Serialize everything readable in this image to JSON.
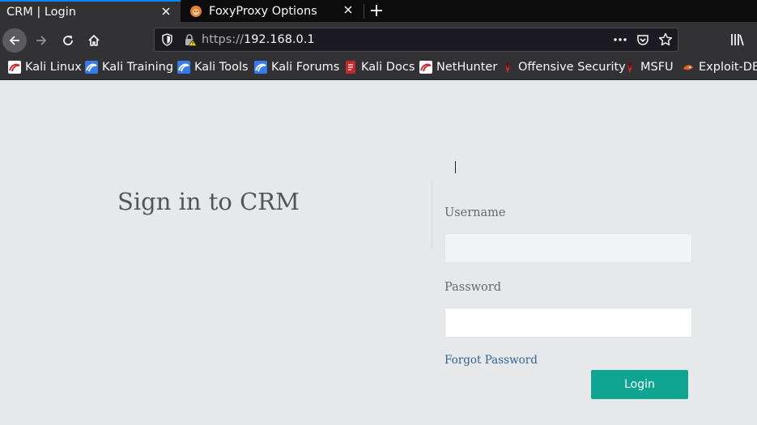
{
  "tabs": [
    {
      "title": "CRM | Login",
      "active": true
    },
    {
      "title": "FoxyProxy Options",
      "active": false
    }
  ],
  "navbar": {
    "url_scheme": "https://",
    "url_host": "192.168.0.1"
  },
  "bookmarks": [
    {
      "label": "Kali Linux",
      "icon": "kali-dragon-icon"
    },
    {
      "label": "Kali Training",
      "icon": "kali-training-icon"
    },
    {
      "label": "Kali Tools",
      "icon": "kali-tools-icon"
    },
    {
      "label": "Kali Forums",
      "icon": "kali-forums-icon"
    },
    {
      "label": "Kali Docs",
      "icon": "kali-docs-icon"
    },
    {
      "label": "NetHunter",
      "icon": "nethunter-icon"
    },
    {
      "label": "Offensive Security",
      "icon": "offsec-icon"
    },
    {
      "label": "MSFU",
      "icon": "msfu-icon"
    },
    {
      "label": "Exploit-DB",
      "icon": "exploit-db-icon"
    }
  ],
  "login": {
    "heading": "Sign in to CRM",
    "username_label": "Username",
    "username_value": "",
    "password_label": "Password",
    "password_value": "",
    "forgot_label": "Forgot Password",
    "submit_label": "Login"
  },
  "colors": {
    "accent": "#0fa593",
    "link": "#2e6592",
    "page_bg": "#e6e8ea",
    "chrome_bg": "#323234",
    "tab_active_indicator": "#0a84ff"
  }
}
